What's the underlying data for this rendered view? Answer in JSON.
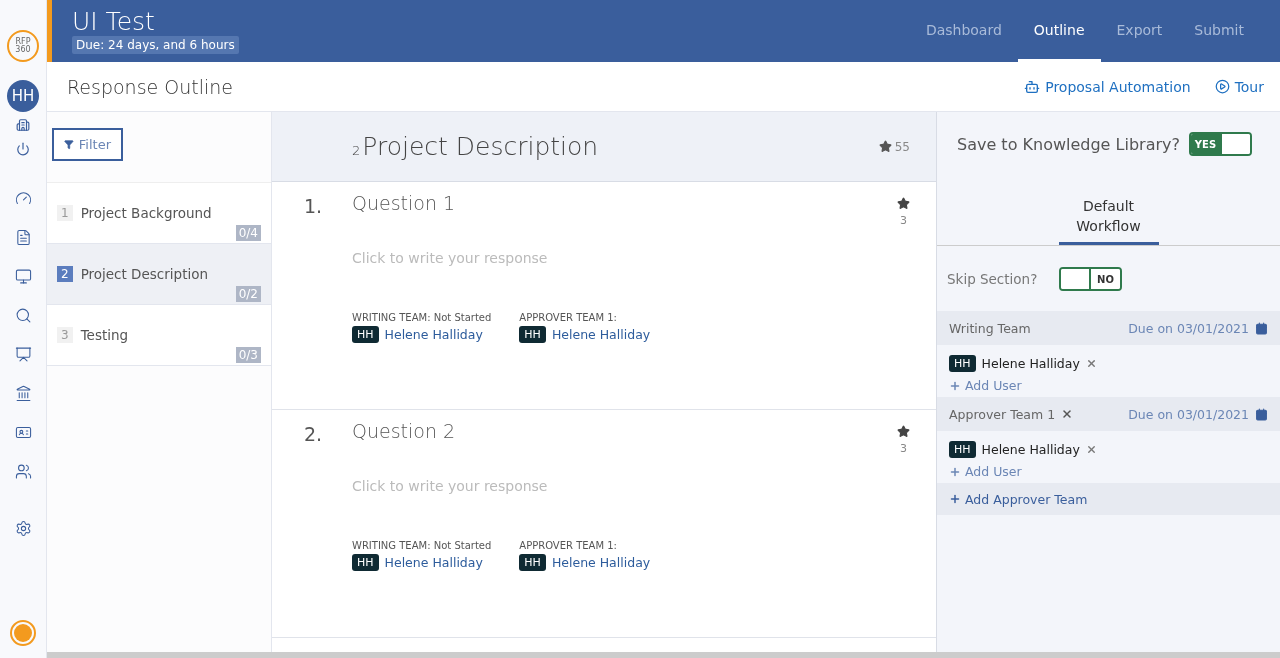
{
  "logo": {
    "lines": [
      "RFP",
      "360"
    ]
  },
  "user": {
    "initials": "HH"
  },
  "header": {
    "title": "UI Test",
    "due": "Due: 24 days, and 6 hours"
  },
  "nav": [
    {
      "label": "Dashboard",
      "selected": false
    },
    {
      "label": "Outline",
      "selected": true
    },
    {
      "label": "Export",
      "selected": false
    },
    {
      "label": "Submit",
      "selected": false
    }
  ],
  "page_title": "Response Outline",
  "actions": [
    {
      "kind": "robot",
      "label": "Proposal Automation"
    },
    {
      "kind": "play",
      "label": "Tour"
    }
  ],
  "filter": "Filter",
  "sections": [
    {
      "number": "1",
      "title": "Project Background",
      "count": "0/4",
      "selected": false
    },
    {
      "number": "2",
      "title": "Project Description",
      "count": "0/2",
      "selected": true
    },
    {
      "number": "3",
      "title": "Testing",
      "count": "0/3",
      "selected": false
    }
  ],
  "section_header": {
    "number": "2",
    "title": "Project Description",
    "stars": "55"
  },
  "questions": [
    {
      "number": "1.",
      "title": "Question 1",
      "stars": "3",
      "placeholder": "Click to write your response",
      "teams": [
        {
          "label": "WRITING TEAM: Not Started",
          "initials": "HH",
          "name": "Helene Halliday"
        },
        {
          "label": "APPROVER TEAM 1:",
          "initials": "HH",
          "name": "Helene Halliday"
        }
      ]
    },
    {
      "number": "2.",
      "title": "Question 2",
      "stars": "3",
      "placeholder": "Click to write your response",
      "teams": [
        {
          "label": "WRITING TEAM: Not Started",
          "initials": "HH",
          "name": "Helene Halliday"
        },
        {
          "label": "APPROVER TEAM 1:",
          "initials": "HH",
          "name": "Helene Halliday"
        }
      ]
    }
  ],
  "panel": {
    "save_label": "Save to Knowledge Library?",
    "save_toggle": {
      "on": true,
      "text": "YES"
    },
    "tabs": [
      {
        "label": "Default Workflow",
        "selected": true
      }
    ],
    "skip_label": "Skip Section?",
    "skip_toggle": {
      "on": false,
      "text": "NO"
    },
    "teams": [
      {
        "name": "Writing Team",
        "removable": false,
        "due": "Due on 03/01/2021",
        "members": [
          {
            "initials": "HH",
            "name": "Helene Halliday"
          }
        ],
        "add_user": "Add User"
      },
      {
        "name": "Approver Team 1",
        "removable": true,
        "due": "Due on 03/01/2021",
        "members": [
          {
            "initials": "HH",
            "name": "Helene Halliday"
          }
        ],
        "add_user": "Add User"
      }
    ],
    "add_team": "Add Approver Team"
  }
}
